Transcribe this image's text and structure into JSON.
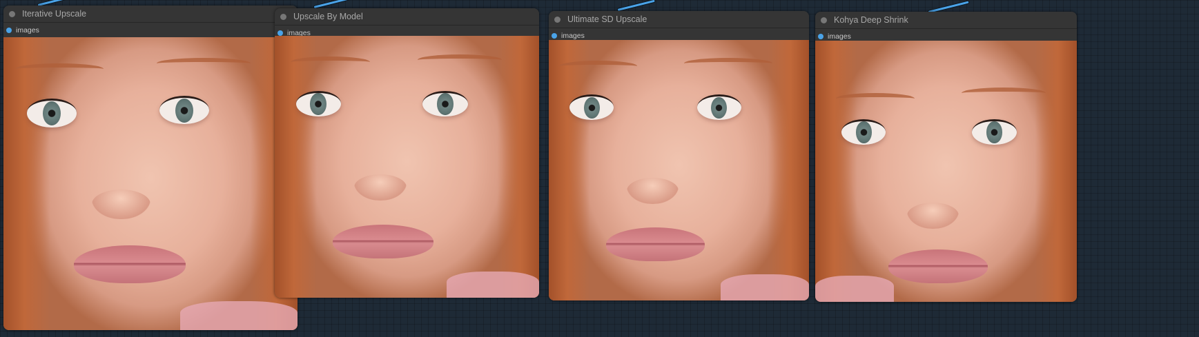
{
  "nodes": [
    {
      "title": "Iterative Upscale",
      "input": "images"
    },
    {
      "title": "Upscale By Model",
      "input": "images"
    },
    {
      "title": "Ultimate SD Upscale",
      "input": "images"
    },
    {
      "title": "Kohya Deep Shrink",
      "input": "images"
    }
  ],
  "colors": {
    "link": "#4aa3e8",
    "node_bg": "#353535",
    "canvas": "#1e2a36"
  }
}
